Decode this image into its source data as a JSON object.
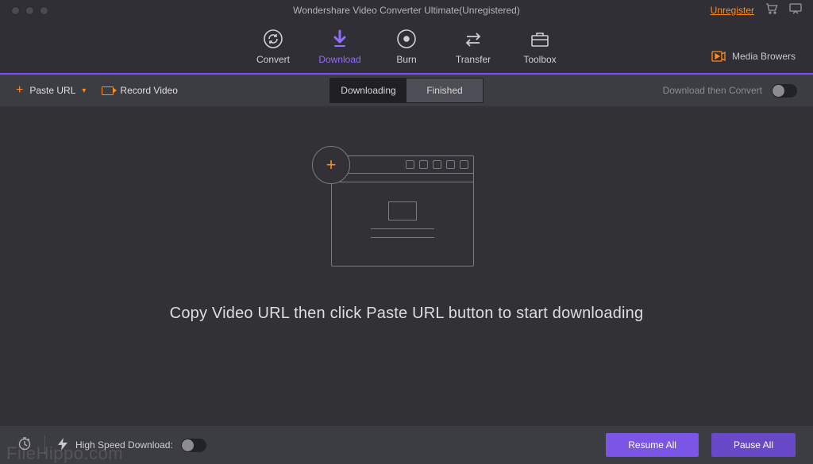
{
  "title": "Wondershare Video Converter Ultimate(Unregistered)",
  "titlebar": {
    "unregister": "Unregister"
  },
  "nav": {
    "convert": "Convert",
    "download": "Download",
    "burn": "Burn",
    "transfer": "Transfer",
    "toolbox": "Toolbox",
    "media_browsers": "Media Browers"
  },
  "subbar": {
    "paste_url": "Paste URL",
    "record_video": "Record Video",
    "tab_downloading": "Downloading",
    "tab_finished": "Finished",
    "download_then_convert": "Download then Convert"
  },
  "canvas": {
    "hint": "Copy Video URL then click Paste URL button to start downloading"
  },
  "bottom": {
    "high_speed": "High Speed Download:",
    "resume_all": "Resume All",
    "pause_all": "Pause All"
  },
  "watermark": "FileHippo.com"
}
